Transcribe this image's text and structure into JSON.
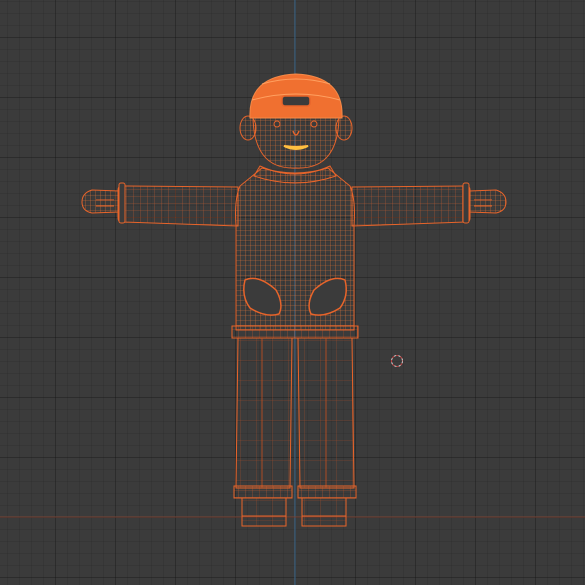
{
  "viewport": {
    "view": "front-orthographic",
    "shading": "wireframe",
    "object": "character-mesh",
    "selected": true
  },
  "colors": {
    "background": "#3b3b3b",
    "grid_minor": "#353535",
    "grid_major": "#2f2f2f",
    "axis_x": "#8a4a3a",
    "axis_z": "#3f6b8f",
    "wire_selected": "#e8642a",
    "wire_dark": "#b8481c",
    "cap_fill": "#f07030",
    "mouth": "#ffc040",
    "cursor": "#d0d0d0"
  },
  "icons": {
    "cursor": "3d-cursor-icon"
  }
}
